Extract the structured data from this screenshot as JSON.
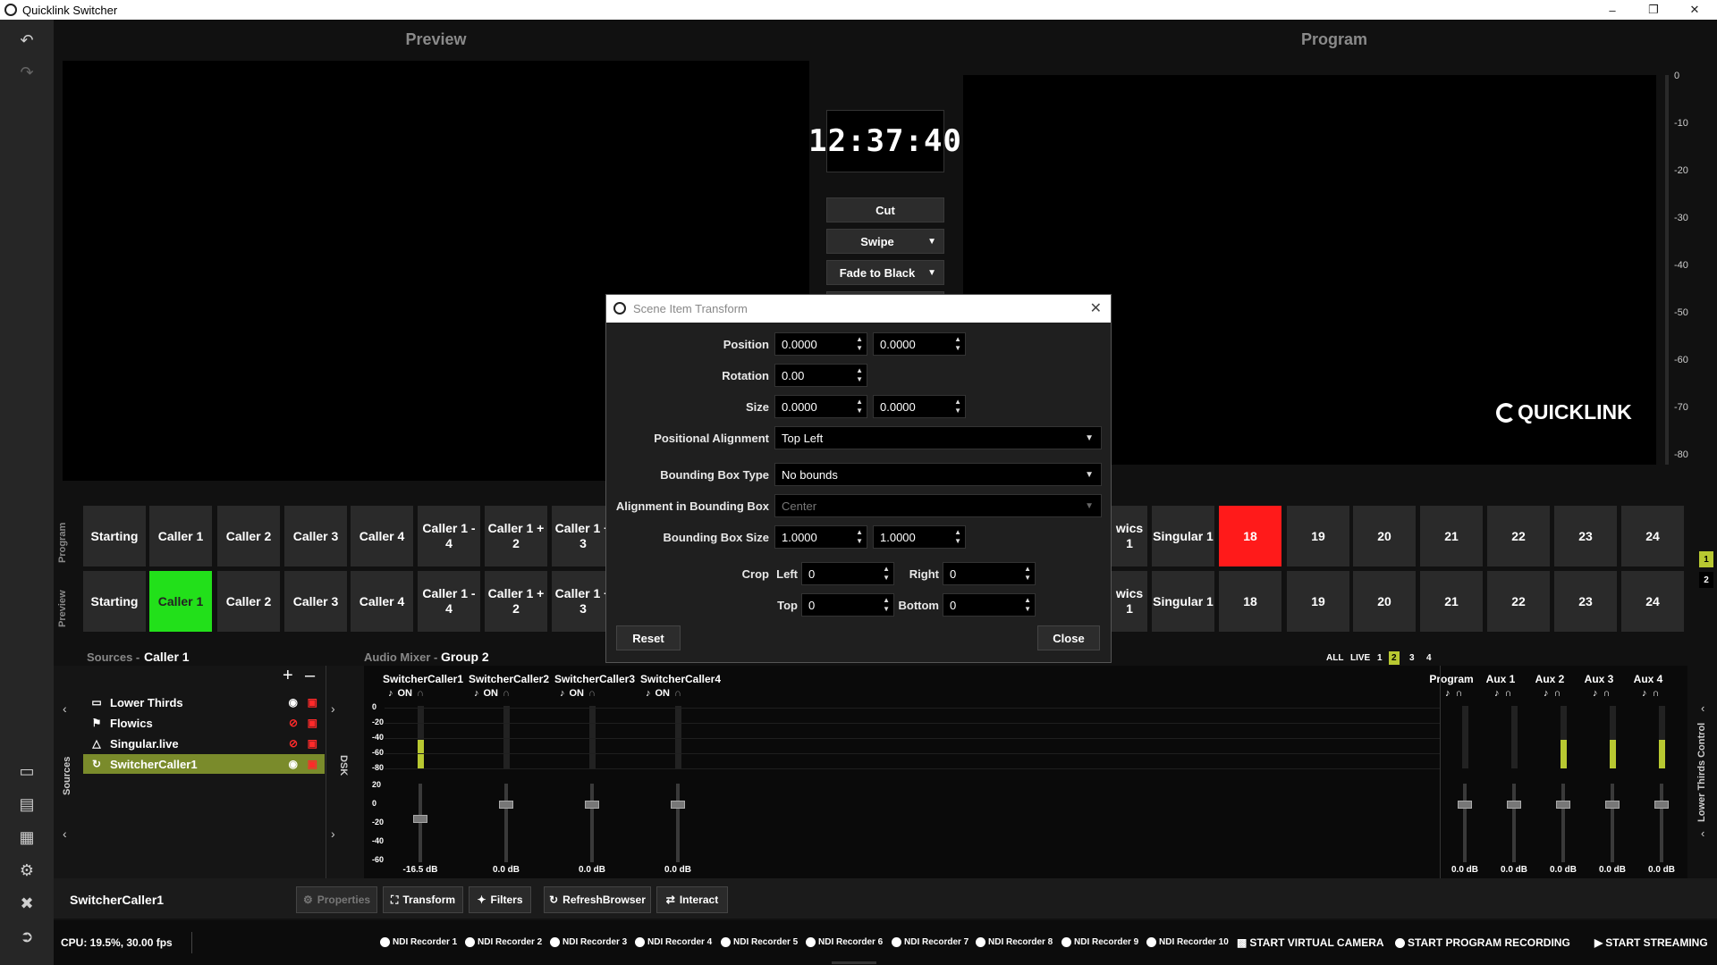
{
  "window": {
    "title": "Quicklink Switcher"
  },
  "headers": {
    "preview": "Preview",
    "program": "Program"
  },
  "clock": "12:37:40",
  "transitions": {
    "cut": "Cut",
    "swipe": "Swipe",
    "fade": "Fade to Black"
  },
  "logo_text": "QUICKLINK",
  "meter_ticks": [
    "0",
    "-10",
    "-20",
    "-30",
    "-40",
    "-50",
    "-60",
    "-70",
    "-80"
  ],
  "row_labels": {
    "program": "Program",
    "preview": "Preview"
  },
  "scenes_left": [
    "Starting",
    "Caller 1",
    "Caller 2",
    "Caller 3",
    "Caller 4",
    "Caller 1 - 4",
    "Caller 1 + 2",
    "Caller 1 + 3"
  ],
  "scenes_right_partial": [
    "wics 1"
  ],
  "scenes_right": [
    "Singular 1",
    "18",
    "19",
    "20",
    "21",
    "22",
    "23",
    "24"
  ],
  "program_active": "18",
  "preview_active": "Caller 1",
  "page_indicators": [
    "1",
    "2"
  ],
  "sources_panel": {
    "label": "Sources",
    "current": "Caller 1",
    "side_label": "Sources",
    "dsk_label": "DSK",
    "items": [
      {
        "name": "Lower Thirds",
        "icon": "lower-thirds-icon"
      },
      {
        "name": "Flowics",
        "icon": "flowics-icon"
      },
      {
        "name": "Singular.live",
        "icon": "singular-icon"
      },
      {
        "name": "SwitcherCaller1",
        "icon": "browser-icon"
      }
    ],
    "selected": "SwitcherCaller1"
  },
  "audio": {
    "label": "Audio Mixer",
    "group": "Group 2",
    "tabs": [
      "ALL",
      "LIVE",
      "1",
      "2",
      "3",
      "4"
    ],
    "active_tab": "2",
    "channels": [
      {
        "name": "SwitcherCaller1",
        "state": "ON",
        "db": "-16.5 dB",
        "level": 0.45
      },
      {
        "name": "SwitcherCaller2",
        "state": "ON",
        "db": "0.0 dB",
        "level": 0
      },
      {
        "name": "SwitcherCaller3",
        "state": "ON",
        "db": "0.0 dB",
        "level": 0
      },
      {
        "name": "SwitcherCaller4",
        "state": "ON",
        "db": "0.0 dB",
        "level": 0
      }
    ],
    "buses": [
      {
        "name": "Program",
        "db": "0.0 dB",
        "level": 0
      },
      {
        "name": "Aux 1",
        "db": "0.0 dB",
        "level": 0
      },
      {
        "name": "Aux 2",
        "db": "0.0 dB",
        "level": 0.45
      },
      {
        "name": "Aux 3",
        "db": "0.0 dB",
        "level": 0.45
      },
      {
        "name": "Aux 4",
        "db": "0.0 dB",
        "level": 0.45
      }
    ],
    "upper_scale": [
      "0",
      "-20",
      "-40",
      "-60",
      "-80"
    ],
    "lower_scale": [
      "20",
      "0",
      "-20",
      "-40",
      "-60"
    ],
    "right_side_label": "Lower Thirds Control"
  },
  "selected_source": "SwitcherCaller1",
  "toolbar": {
    "properties": "Properties",
    "transform": "Transform",
    "filters": "Filters",
    "refresh": "RefreshBrowser",
    "interact": "Interact"
  },
  "status": {
    "cpu": "CPU: 19.5%, 30.00 fps",
    "recorders": [
      "NDI Recorder 1",
      "NDI Recorder 2",
      "NDI Recorder 3",
      "NDI Recorder 4",
      "NDI Recorder 5",
      "NDI Recorder 6",
      "NDI Recorder 7",
      "NDI Recorder 8",
      "NDI Recorder 9",
      "NDI Recorder 10"
    ],
    "virtual_camera": "START VIRTUAL CAMERA",
    "program_recording": "START PROGRAM RECORDING",
    "streaming": "START STREAMING"
  },
  "dialog": {
    "title": "Scene Item Transform",
    "position_label": "Position",
    "position_x": "0.0000",
    "position_y": "0.0000",
    "rotation_label": "Rotation",
    "rotation": "0.00",
    "size_label": "Size",
    "size_x": "0.0000",
    "size_y": "0.0000",
    "alignment_label": "Positional Alignment",
    "alignment": "Top Left",
    "bbox_type_label": "Bounding Box Type",
    "bbox_type": "No bounds",
    "bbox_align_label": "Alignment in Bounding Box",
    "bbox_align": "Center",
    "bbox_size_label": "Bounding Box Size",
    "bbox_w": "1.0000",
    "bbox_h": "1.0000",
    "crop_label": "Crop",
    "left_label": "Left",
    "left": "0",
    "right_label": "Right",
    "right": "0",
    "top_label": "Top",
    "top": "0",
    "bottom_label": "Bottom",
    "bottom": "0",
    "reset": "Reset",
    "close": "Close"
  }
}
